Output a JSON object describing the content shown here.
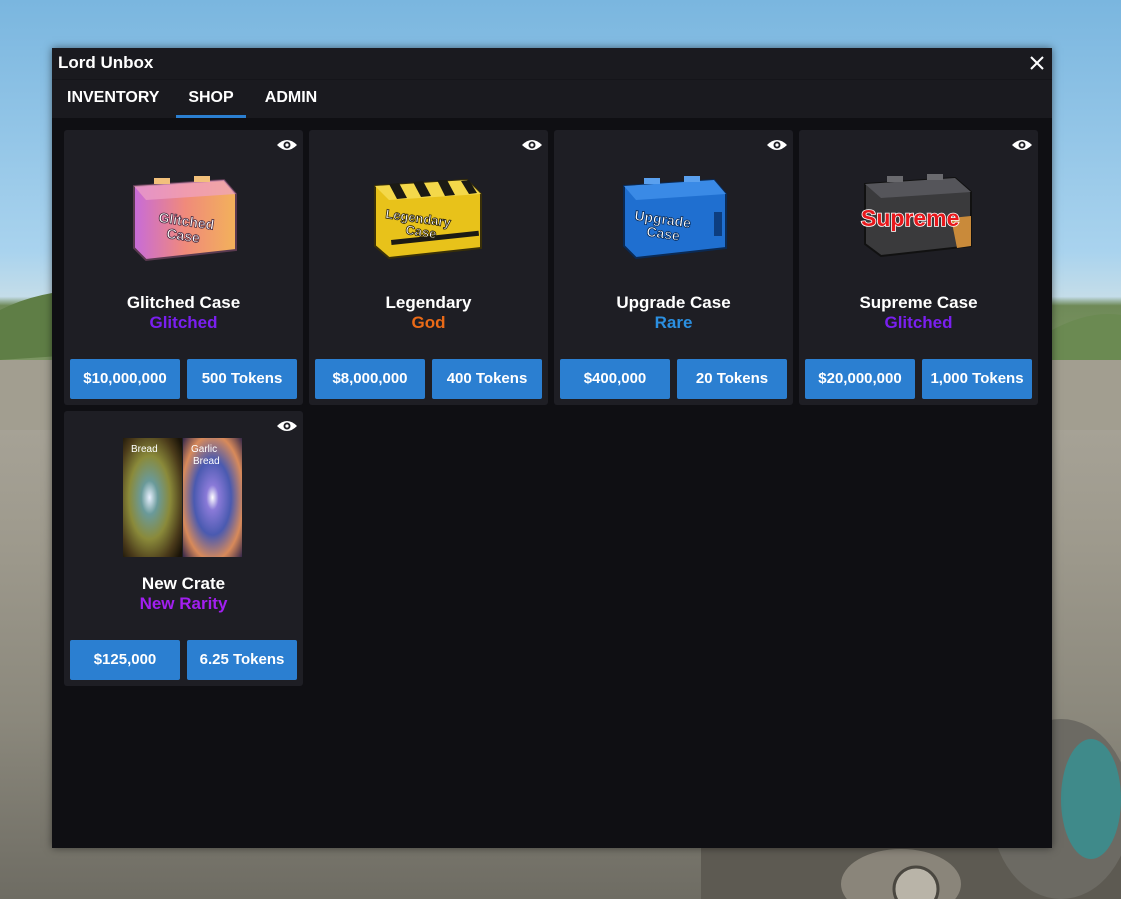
{
  "window": {
    "title": "Lord Unbox"
  },
  "tabs": [
    {
      "label": "INVENTORY",
      "active": false
    },
    {
      "label": "SHOP",
      "active": true
    },
    {
      "label": "ADMIN",
      "active": false
    }
  ],
  "cases": [
    {
      "name": "Glitched Case",
      "rarity": "Glitched",
      "rarity_color": "#7a1ff0",
      "price_money": "$10,000,000",
      "price_tokens": "500 Tokens",
      "crate_text": [
        "Glitched",
        "Case"
      ],
      "icon": "glitched-case"
    },
    {
      "name": "Legendary",
      "rarity": "God",
      "rarity_color": "#ea6a17",
      "price_money": "$8,000,000",
      "price_tokens": "400 Tokens",
      "crate_text": [
        "Legendary",
        "Case"
      ],
      "icon": "legendary-case"
    },
    {
      "name": "Upgrade Case",
      "rarity": "Rare",
      "rarity_color": "#2b8fe0",
      "price_money": "$400,000",
      "price_tokens": "20 Tokens",
      "crate_text": [
        "Upgrade",
        "Case"
      ],
      "icon": "upgrade-case"
    },
    {
      "name": "Supreme Case",
      "rarity": "Glitched",
      "rarity_color": "#7a1ff0",
      "price_money": "$20,000,000",
      "price_tokens": "1,000 Tokens",
      "crate_text": [
        "Supreme"
      ],
      "icon": "supreme-case"
    },
    {
      "name": "New Crate",
      "rarity": "New Rarity",
      "rarity_color": "#a21ff0",
      "price_money": "$125,000",
      "price_tokens": "6.25 Tokens",
      "crate_text": [
        "Bread",
        "Garlic",
        "Bread"
      ],
      "icon": "bread-crate"
    }
  ],
  "icons": {
    "preview": "eye-icon",
    "close": "close-icon"
  },
  "colors": {
    "accent": "#2b7fd1",
    "card_bg": "#1e1e24",
    "window_bg": "#0f0f13"
  }
}
